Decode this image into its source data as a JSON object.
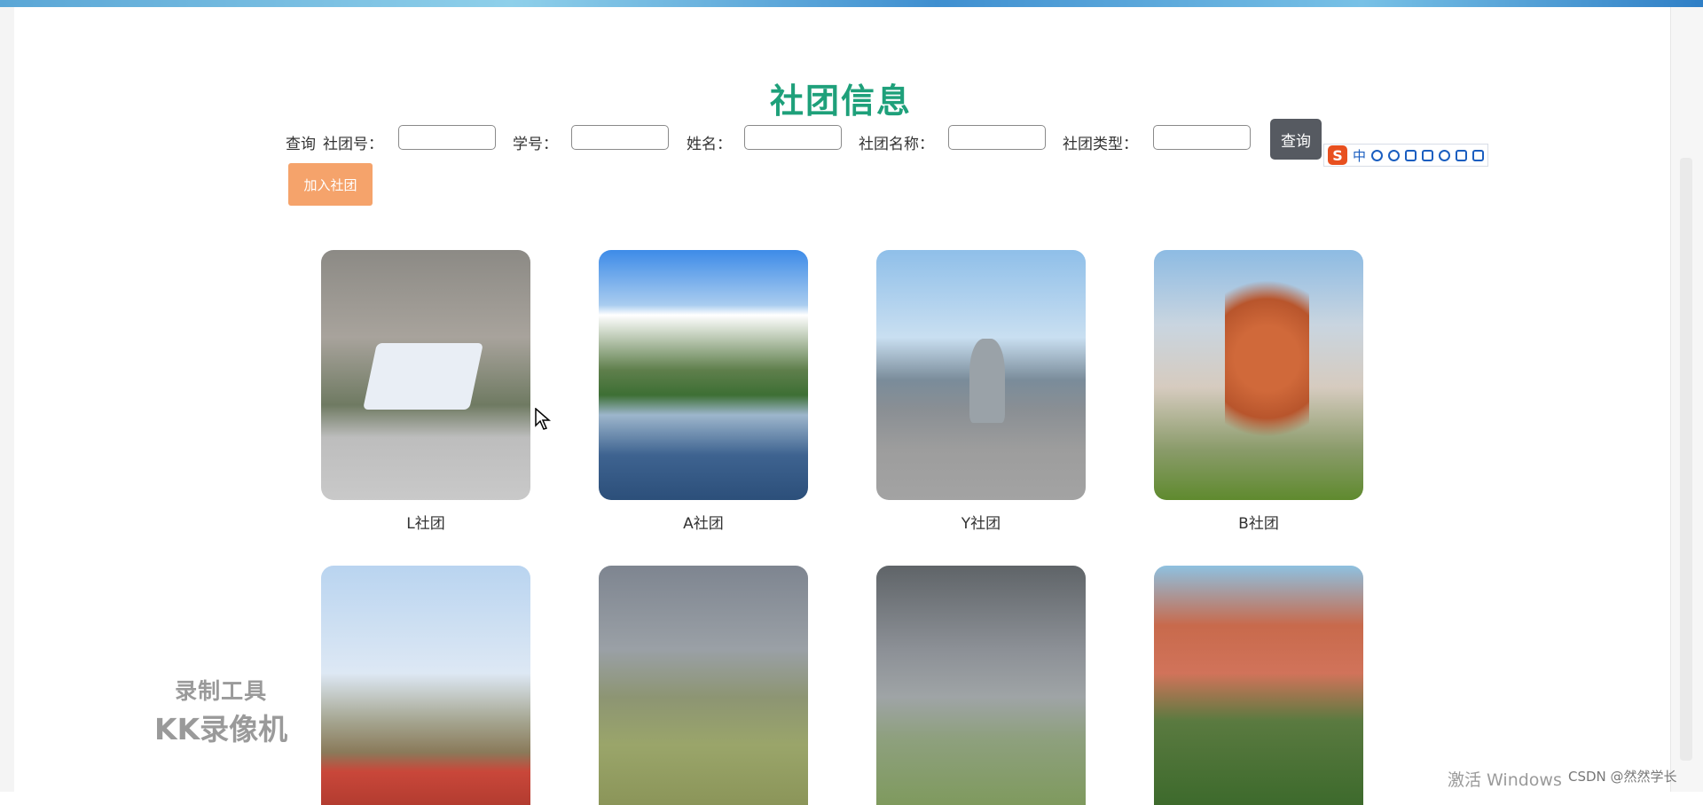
{
  "page": {
    "title": "社团信息"
  },
  "search": {
    "prefix": "查询",
    "fields": [
      {
        "label": "社团号：",
        "value": ""
      },
      {
        "label": "学号：",
        "value": ""
      },
      {
        "label": "姓名：",
        "value": ""
      },
      {
        "label": "社团名称：",
        "value": ""
      },
      {
        "label": "社团类型：",
        "value": ""
      }
    ],
    "query_button": "查询",
    "add_button": "加入社团"
  },
  "clubs": [
    {
      "name": "L社团"
    },
    {
      "name": "A社团"
    },
    {
      "name": "Y社团"
    },
    {
      "name": "B社团"
    },
    {
      "name": ""
    },
    {
      "name": ""
    },
    {
      "name": ""
    },
    {
      "name": ""
    }
  ],
  "ime": {
    "logo": "S",
    "mode": "中",
    "icons": [
      "punctuation-icon",
      "emoji-icon",
      "microphone-icon",
      "keyboard-icon",
      "user-icon",
      "shirt-icon",
      "grid-icon"
    ]
  },
  "watermark": {
    "line1": "录制工具",
    "line2": "KK录像机"
  },
  "overlay": {
    "activate": "激活 Windows",
    "csdn": "CSDN @然然学长"
  }
}
